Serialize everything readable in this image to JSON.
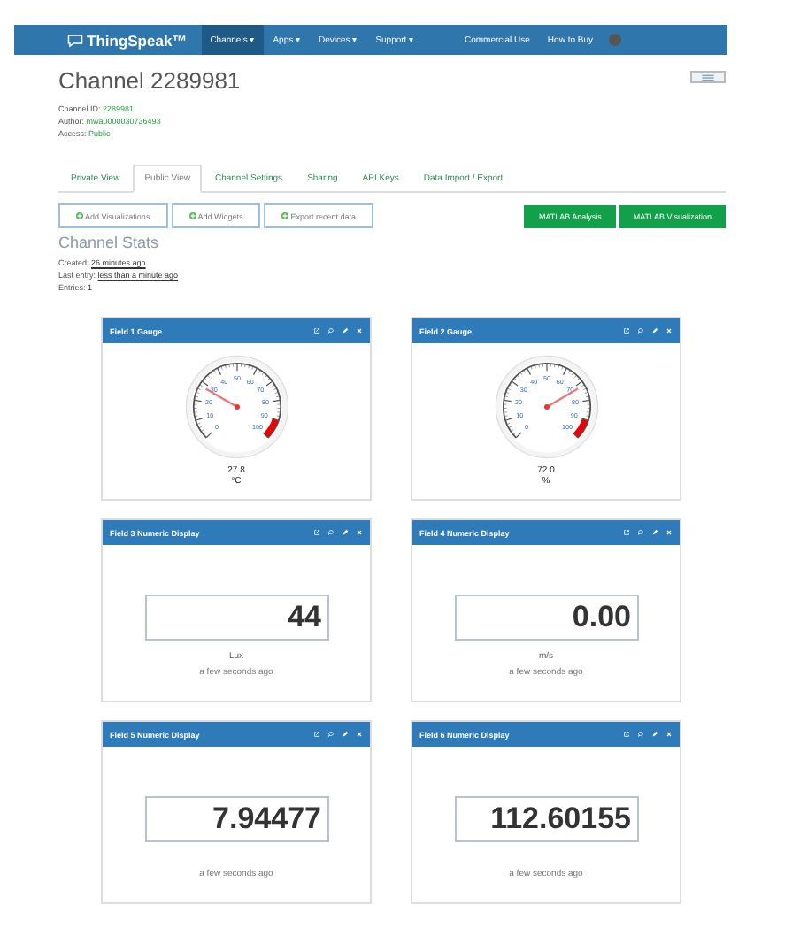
{
  "navbar": {
    "brand": "ThingSpeak™",
    "menu": [
      {
        "label": "Channels ▾",
        "selected": true
      },
      {
        "label": "Apps ▾",
        "selected": false
      },
      {
        "label": "Devices ▾",
        "selected": false
      },
      {
        "label": "Support ▾",
        "selected": false
      }
    ],
    "right_links": [
      "Commercial Use",
      "How to Buy"
    ]
  },
  "channel": {
    "title": "Channel 2289981",
    "info": [
      {
        "label": "Channel ID:",
        "value": "2289981"
      },
      {
        "label": "Author:",
        "value": "mwa0000030736493"
      },
      {
        "label": "Access:",
        "value": "Public"
      }
    ]
  },
  "tabs": [
    {
      "label": "Private View",
      "selected": false
    },
    {
      "label": "Public View",
      "selected": true
    },
    {
      "label": "Channel Settings",
      "selected": false
    },
    {
      "label": "Sharing",
      "selected": false
    },
    {
      "label": "API Keys",
      "selected": false
    },
    {
      "label": "Data Import / Export",
      "selected": false
    }
  ],
  "actions": [
    "Add Visualizations",
    "Add Widgets",
    "Export recent data"
  ],
  "matlab_buttons": [
    "MATLAB Analysis",
    "MATLAB Visualization"
  ],
  "stats": {
    "title": "Channel Stats",
    "rows": [
      {
        "label": "Created:",
        "value": "26 minutes ago"
      },
      {
        "label": "Last entry:",
        "value": "less than a minute ago"
      },
      {
        "label": "Entries:",
        "value": "1"
      }
    ]
  },
  "widgets": [
    {
      "kind": "gauge",
      "title": "Field 1 Gauge",
      "value": "27.8",
      "unit": "°C",
      "ticks": [
        "0",
        "10",
        "20",
        "30",
        "40",
        "50",
        "60",
        "70",
        "80",
        "90",
        "100"
      ]
    },
    {
      "kind": "gauge",
      "title": "Field 2 Gauge",
      "value": "72.0",
      "unit": "%",
      "ticks": [
        "0",
        "10",
        "20",
        "30",
        "40",
        "50",
        "60",
        "70",
        "80",
        "90",
        "100"
      ]
    },
    {
      "kind": "numeric",
      "title": "Field 3 Numeric Display",
      "value": "44",
      "unit": "Lux",
      "time": "a few seconds ago"
    },
    {
      "kind": "numeric",
      "title": "Field 4 Numeric Display",
      "value": "0.00",
      "unit": "m/s",
      "time": "a few seconds ago"
    },
    {
      "kind": "numeric",
      "title": "Field 5 Numeric Display",
      "value": "7.94477",
      "time": "a few seconds ago"
    },
    {
      "kind": "numeric",
      "title": "Field 6 Numeric Display",
      "value": "112.60155",
      "time": "a few seconds ago"
    }
  ]
}
